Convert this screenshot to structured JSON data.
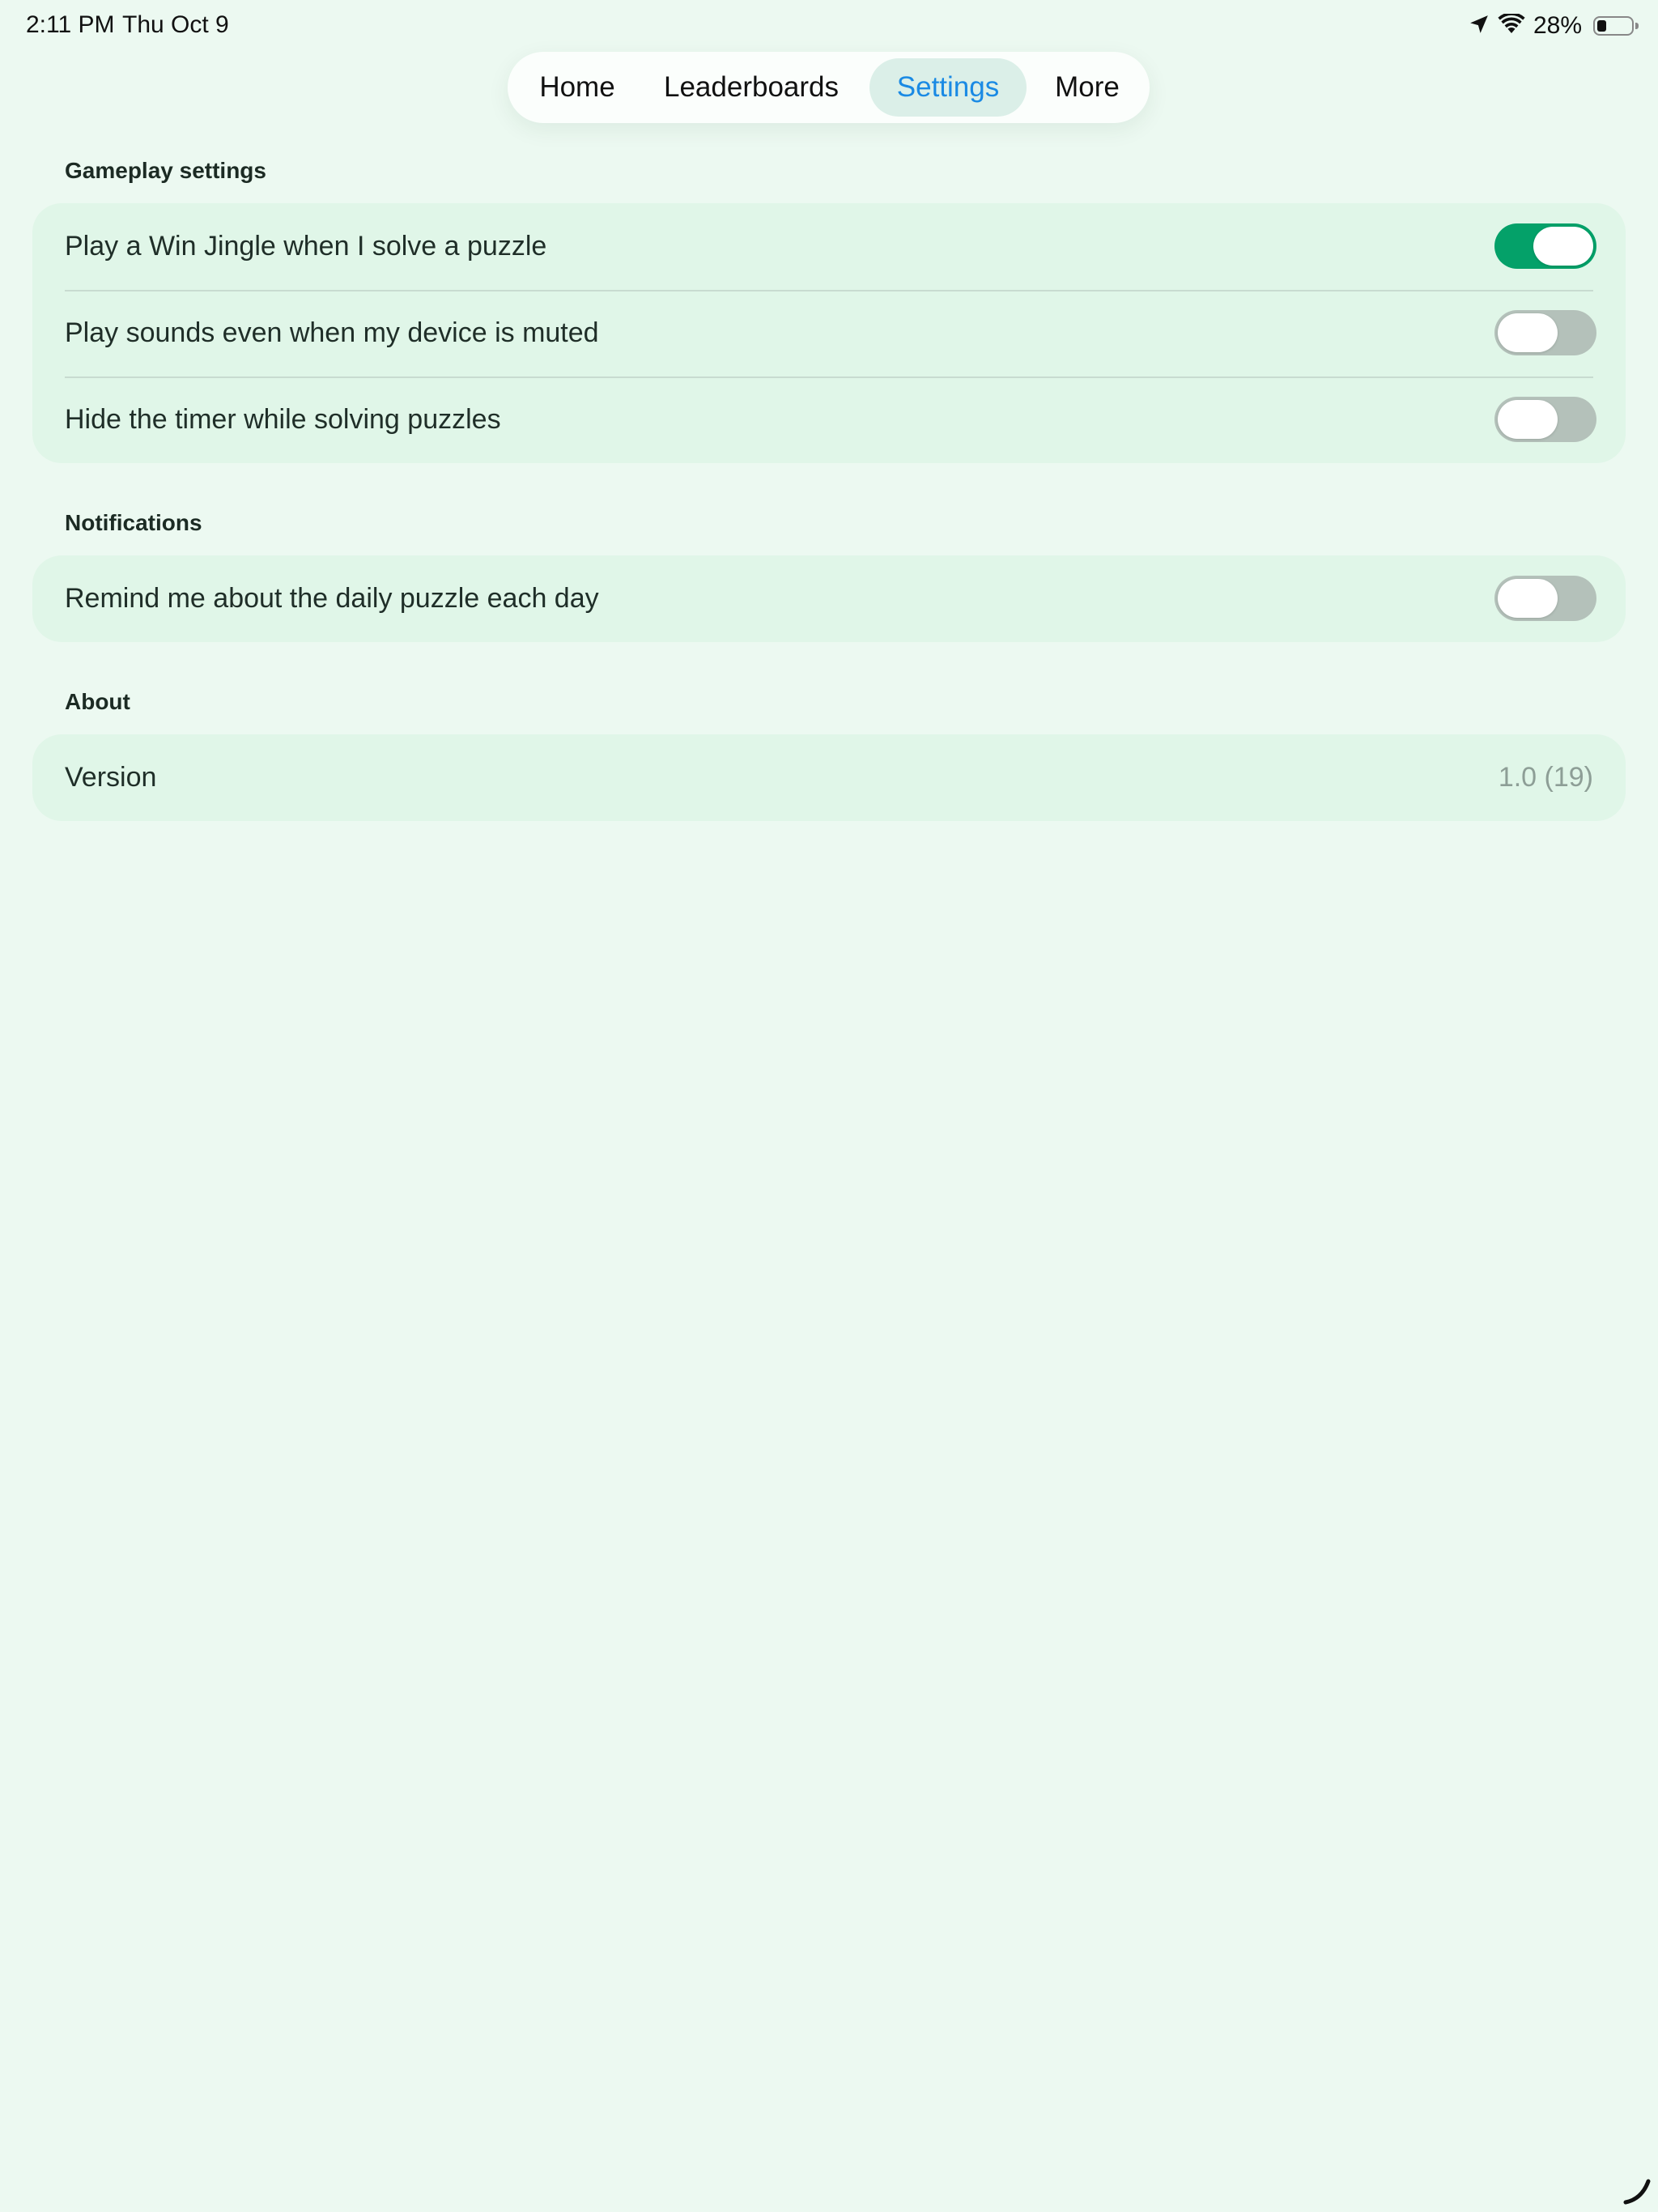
{
  "status_bar": {
    "time": "2:11 PM",
    "date": "Thu Oct 9",
    "battery_percent": "28%",
    "battery_level": 0.28,
    "icons": [
      "location-arrow-icon",
      "wifi-icon",
      "battery-icon"
    ]
  },
  "tabs": [
    {
      "label": "Home",
      "active": false
    },
    {
      "label": "Leaderboards",
      "active": false
    },
    {
      "label": "Settings",
      "active": true
    },
    {
      "label": "More",
      "active": false
    }
  ],
  "sections": {
    "gameplay": {
      "title": "Gameplay settings",
      "rows": [
        {
          "label": "Play a Win Jingle when I solve a puzzle",
          "on": true
        },
        {
          "label": "Play sounds even when my device is muted",
          "on": false
        },
        {
          "label": "Hide the timer while solving puzzles",
          "on": false
        }
      ]
    },
    "notifications": {
      "title": "Notifications",
      "rows": [
        {
          "label": "Remind me about the daily puzzle each day",
          "on": false
        }
      ]
    },
    "about": {
      "title": "About",
      "rows": [
        {
          "label": "Version",
          "value": "1.0 (19)"
        }
      ]
    }
  },
  "colors": {
    "background": "#ecf9f1",
    "card": "#e0f6e8",
    "toggle_on": "#04a169",
    "toggle_off": "#b4c1ba",
    "active_tab_text": "#1a8ae4",
    "active_tab_bg": "#dbefe8"
  }
}
